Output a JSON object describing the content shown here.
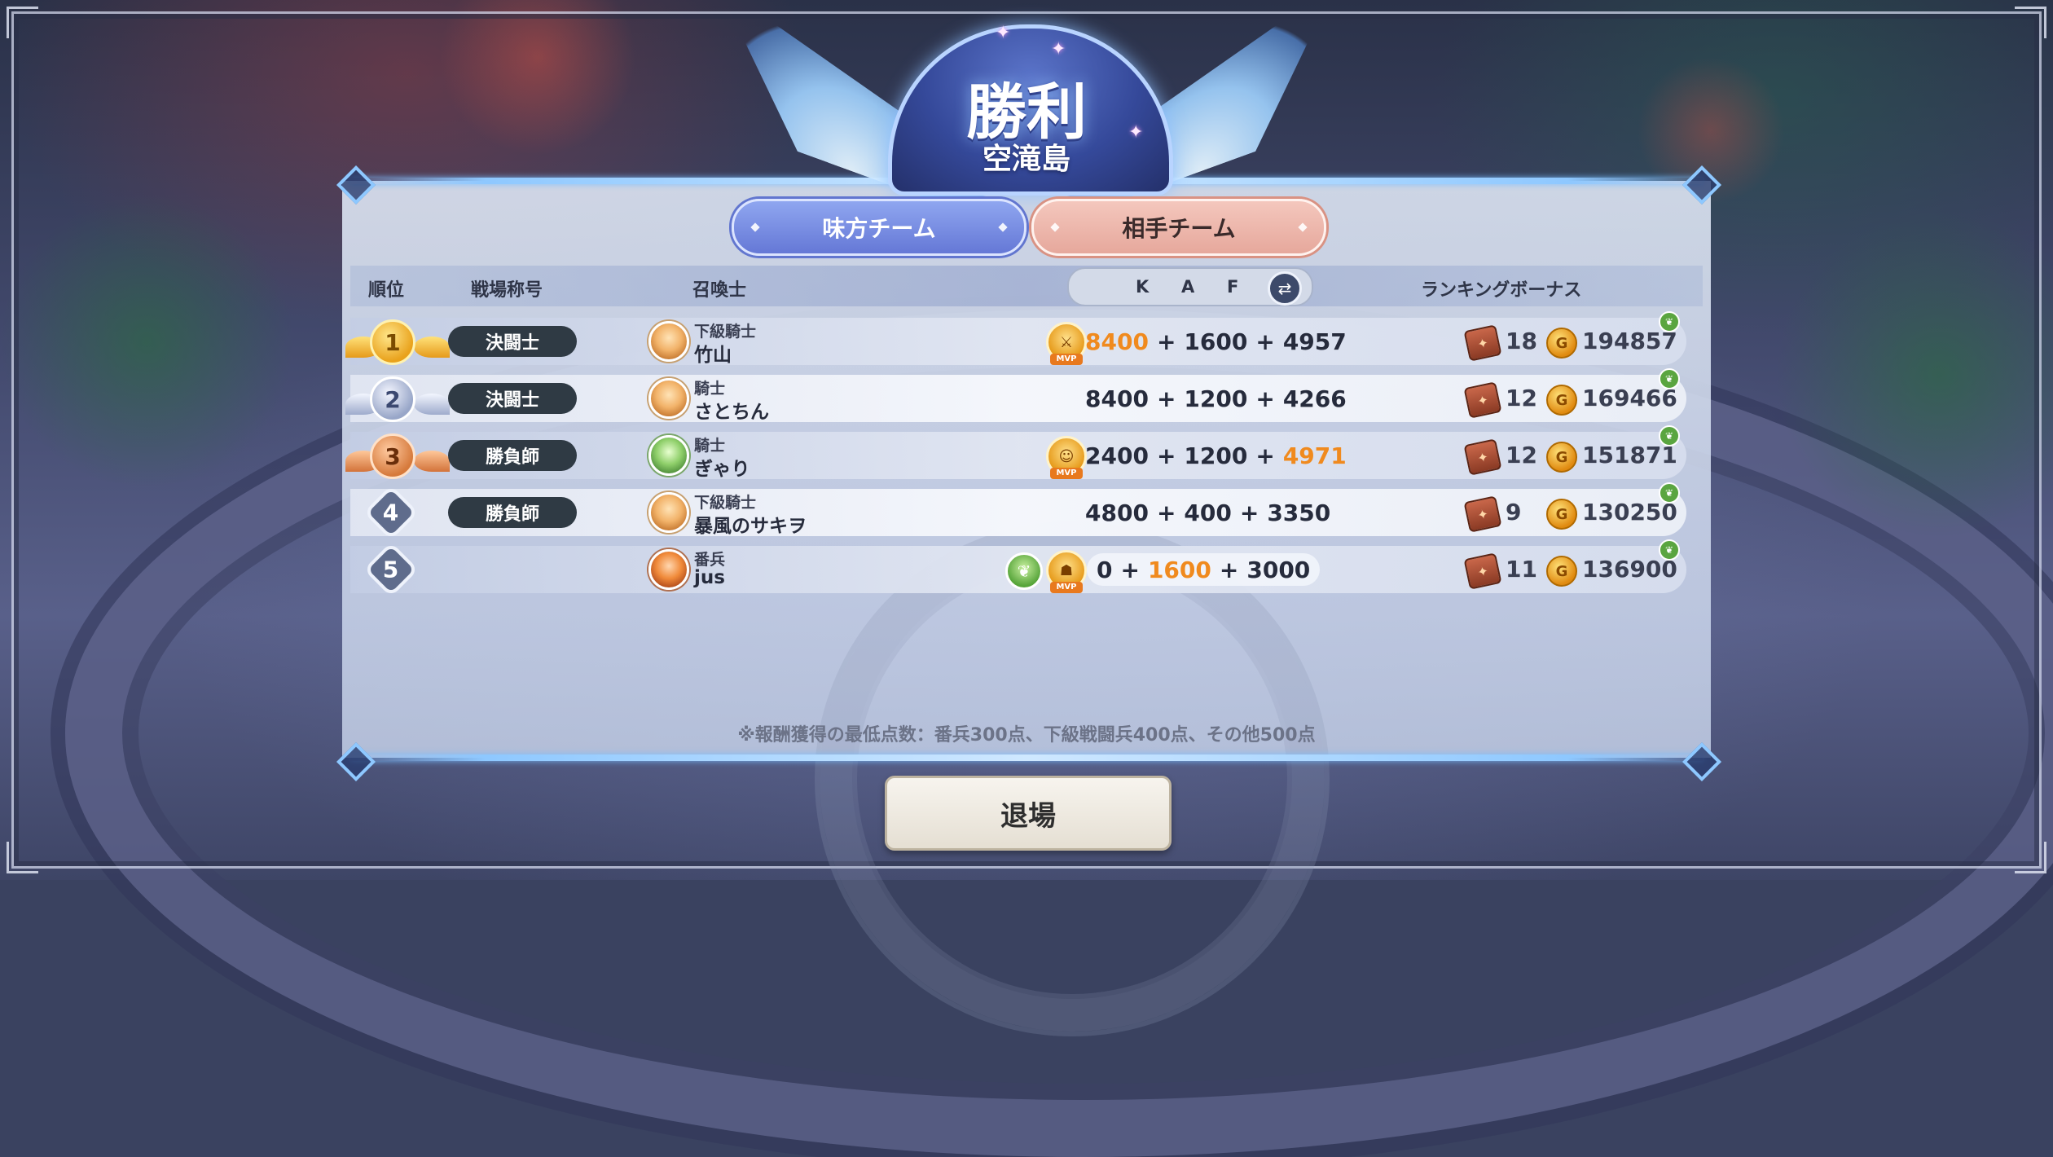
{
  "result": {
    "title": "勝利",
    "map_name": "空滝島"
  },
  "tabs": {
    "ally": "味方チーム",
    "enemy": "相手チーム",
    "active": "enemy"
  },
  "table_header": {
    "rank": "順位",
    "battle_title": "戦場称号",
    "summoner": "召喚士",
    "k": "K",
    "a": "A",
    "f": "F",
    "swap_icon": "swap-arrows-icon",
    "ranking_bonus": "ランキングボーナス"
  },
  "rows": [
    {
      "rank": "1",
      "rank_style": "gold",
      "battle_title": "決闘士",
      "rank_name": "下級騎士",
      "player": "竹山",
      "badges": [
        "mvp-killer-icon"
      ],
      "k": "8400",
      "a": "1600",
      "f": "4957",
      "highlight": [
        "k"
      ],
      "chest_count": "18",
      "points": "194857"
    },
    {
      "rank": "2",
      "rank_style": "silver",
      "battle_title": "決闘士",
      "rank_name": "騎士",
      "player": "さとちん",
      "badges": [],
      "k": "8400",
      "a": "1200",
      "f": "4266",
      "highlight": [],
      "chest_count": "12",
      "points": "169466"
    },
    {
      "rank": "3",
      "rank_style": "bronze",
      "battle_title": "勝負師",
      "rank_name": "騎士",
      "player": "ぎゃり",
      "badges": [
        "mvp-face-icon"
      ],
      "k": "2400",
      "a": "1200",
      "f": "4971",
      "highlight": [
        "f"
      ],
      "chest_count": "12",
      "points": "151871"
    },
    {
      "rank": "4",
      "rank_style": "plain",
      "battle_title": "勝負師",
      "rank_name": "下級騎士",
      "player": "暴風のサキヲ",
      "badges": [],
      "k": "4800",
      "a": "400",
      "f": "3350",
      "highlight": [],
      "chest_count": "9",
      "points": "130250"
    },
    {
      "rank": "5",
      "rank_style": "plain",
      "battle_title": "",
      "rank_name": "番兵",
      "player": "jus",
      "badges": [
        "leaf-icon",
        "mvp-helper-icon"
      ],
      "k": "0",
      "a": "1600",
      "f": "3000",
      "highlight": [
        "a"
      ],
      "chest_count": "11",
      "points": "136900"
    }
  ],
  "note": "※報酬獲得の最低点数：番兵300点、下級戦闘兵400点、その他500点",
  "exit_button": "退場",
  "colors": {
    "highlight": "#f08a1e",
    "ally_tab": "#6578d6",
    "enemy_tab": "#e6a89c",
    "badge_bg": "#2f3a44"
  }
}
